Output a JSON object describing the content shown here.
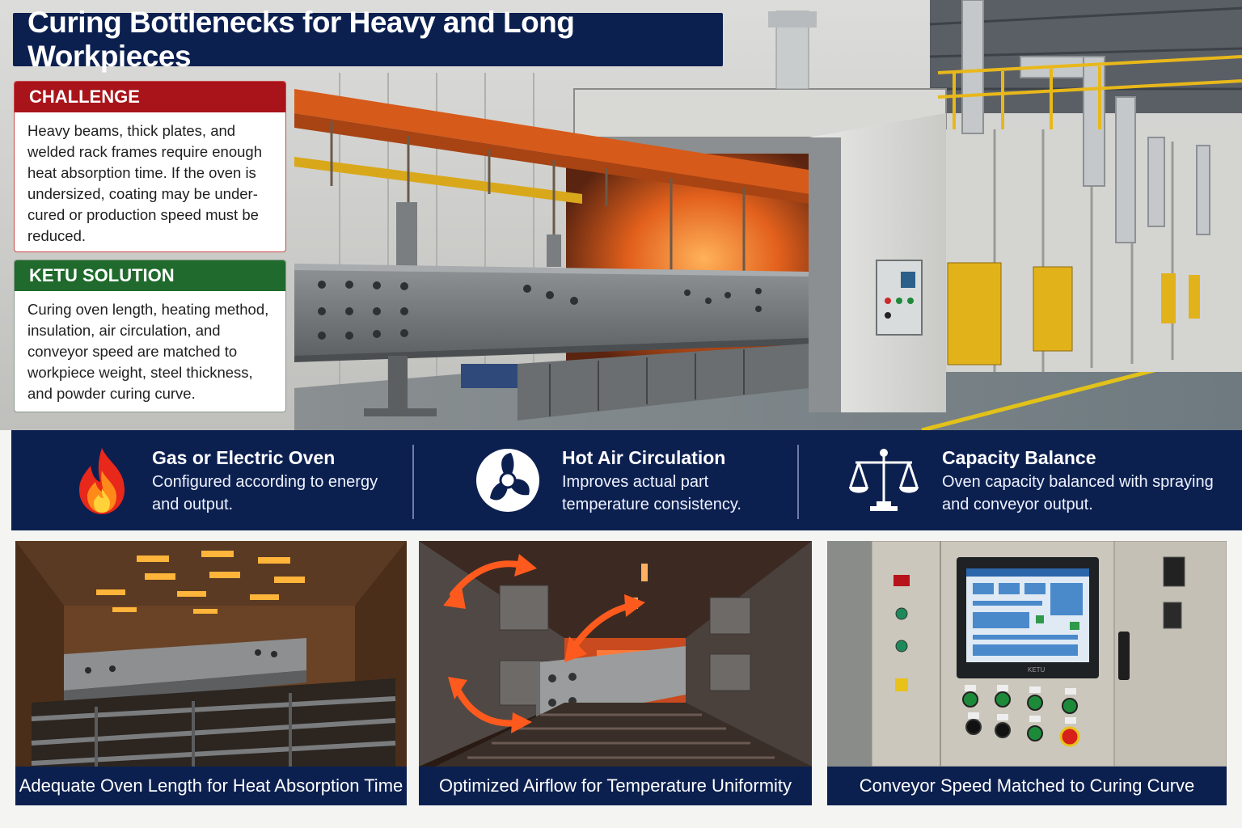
{
  "title": "Curing Bottlenecks for Heavy and Long Workpieces",
  "challenge": {
    "heading": "CHALLENGE",
    "text": "Heavy beams, thick plates, and welded rack frames require enough heat absorption time. If the oven is undersized, coating may be under-cured or production speed must be reduced."
  },
  "solution": {
    "heading": "KETU SOLUTION",
    "text": "Curing oven length, heating method, insulation, air circulation, and conveyor speed are matched to workpiece weight, steel thickness, and powder curing curve."
  },
  "features": [
    {
      "icon": "flame-icon",
      "title": "Gas or Electric Oven",
      "desc": "Configured according to energy and output."
    },
    {
      "icon": "fan-icon",
      "title": "Hot Air Circulation",
      "desc": "Improves actual part temperature consistency."
    },
    {
      "icon": "balance-scale-icon",
      "title": "Capacity Balance",
      "desc": "Oven capacity balanced with spraying and conveyor output."
    }
  ],
  "panels": [
    {
      "caption": "Adequate Oven Length for Heat Absorption Time"
    },
    {
      "caption": "Optimized Airflow for Temperature Uniformity"
    },
    {
      "caption": "Conveyor Speed Matched to Curing Curve"
    }
  ],
  "control_panel_brand": "KETU",
  "colors": {
    "navy": "#0c2050",
    "challenge_red": "#a8141a",
    "solution_green": "#1f6a2c",
    "conveyor_orange": "#d65a1a",
    "panel_yellow": "#e2b21a"
  }
}
